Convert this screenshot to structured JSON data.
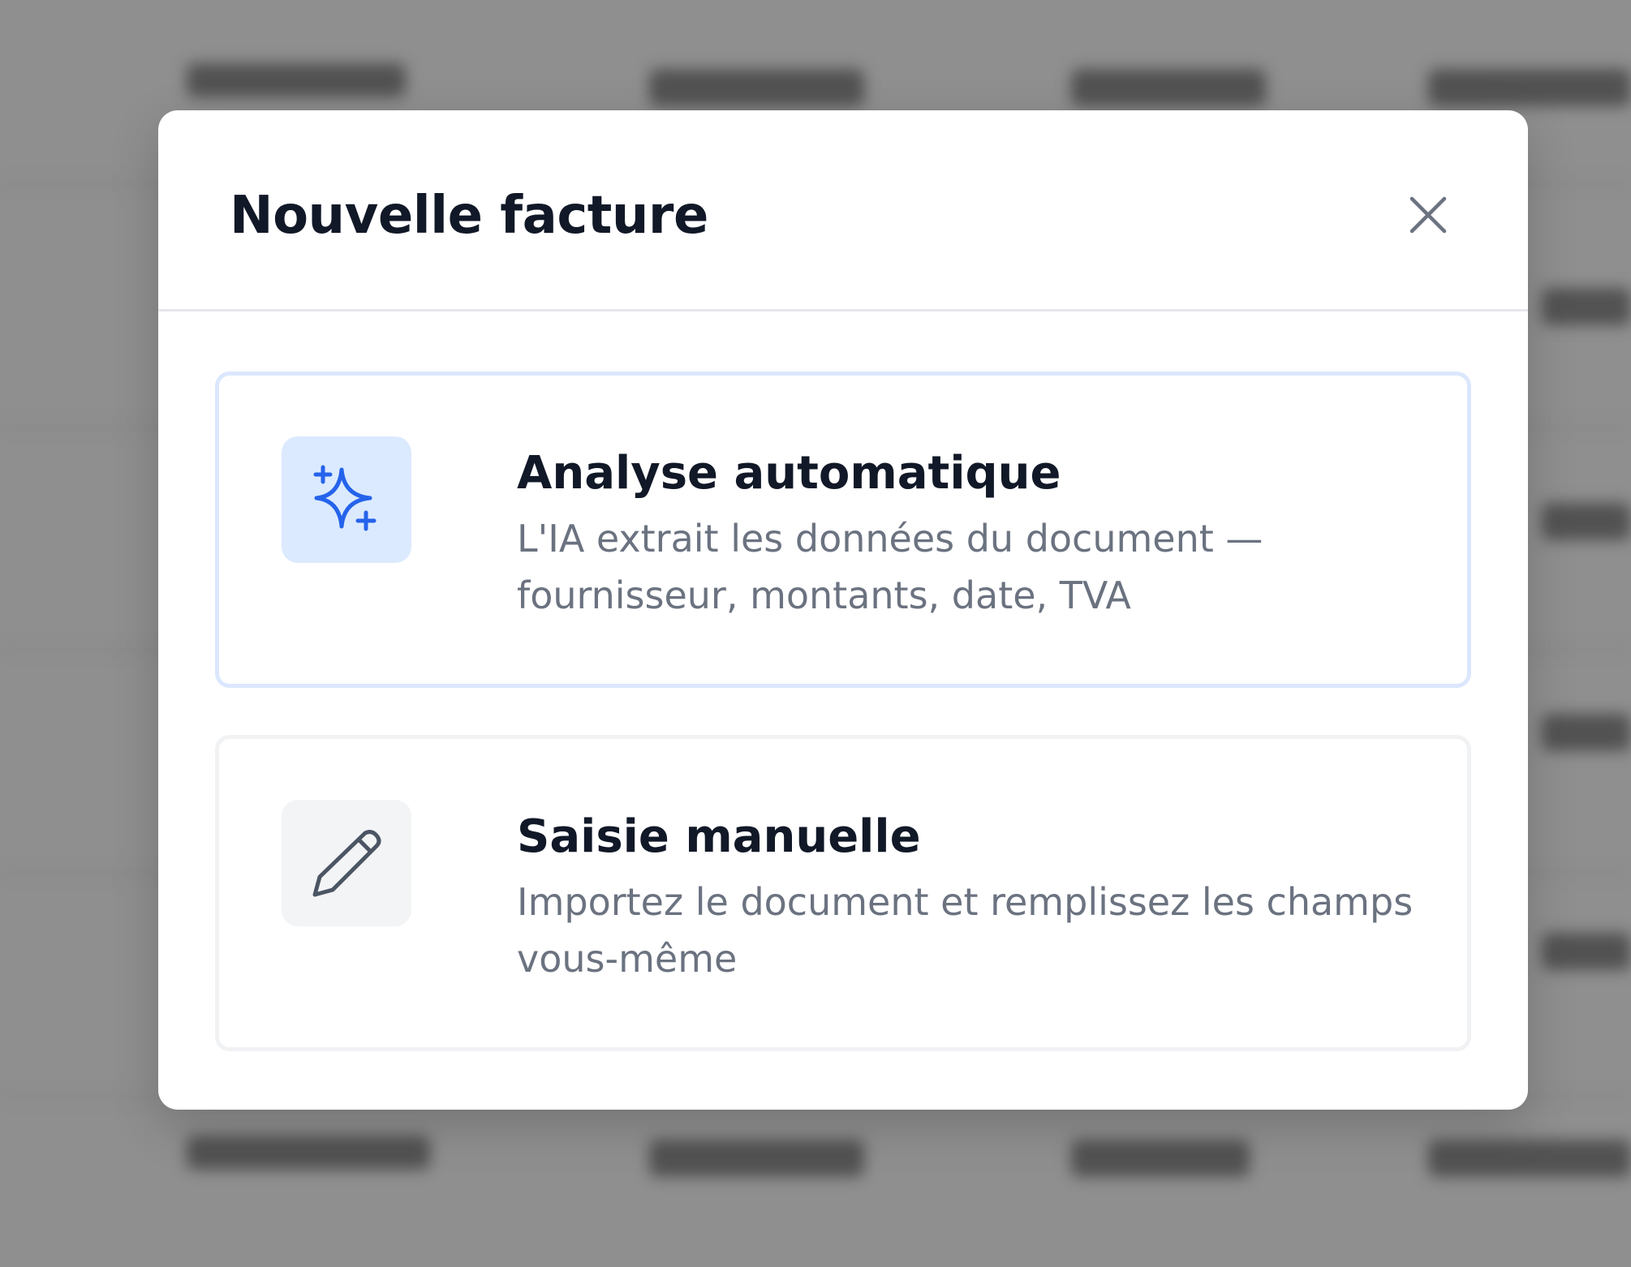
{
  "modal": {
    "title": "Nouvelle facture",
    "close_icon": "close-icon"
  },
  "options": [
    {
      "title": "Analyse automatique",
      "description": "L'IA extrait les données du document — fournisseur, montants, date, TVA",
      "icon": "sparkles-icon",
      "icon_color": "#2563eb",
      "icon_bg": "#dbeafe"
    },
    {
      "title": "Saisie manuelle",
      "description": "Importez le document et remplissez les champs vous-même",
      "icon": "pencil-icon",
      "icon_color": "#4b5563",
      "icon_bg": "#f3f4f6"
    }
  ],
  "colors": {
    "overlay": "#8f8f8f",
    "title": "#111827",
    "description": "#6b7280",
    "selected_border": "#dbe7fd",
    "accent": "#2563eb"
  }
}
